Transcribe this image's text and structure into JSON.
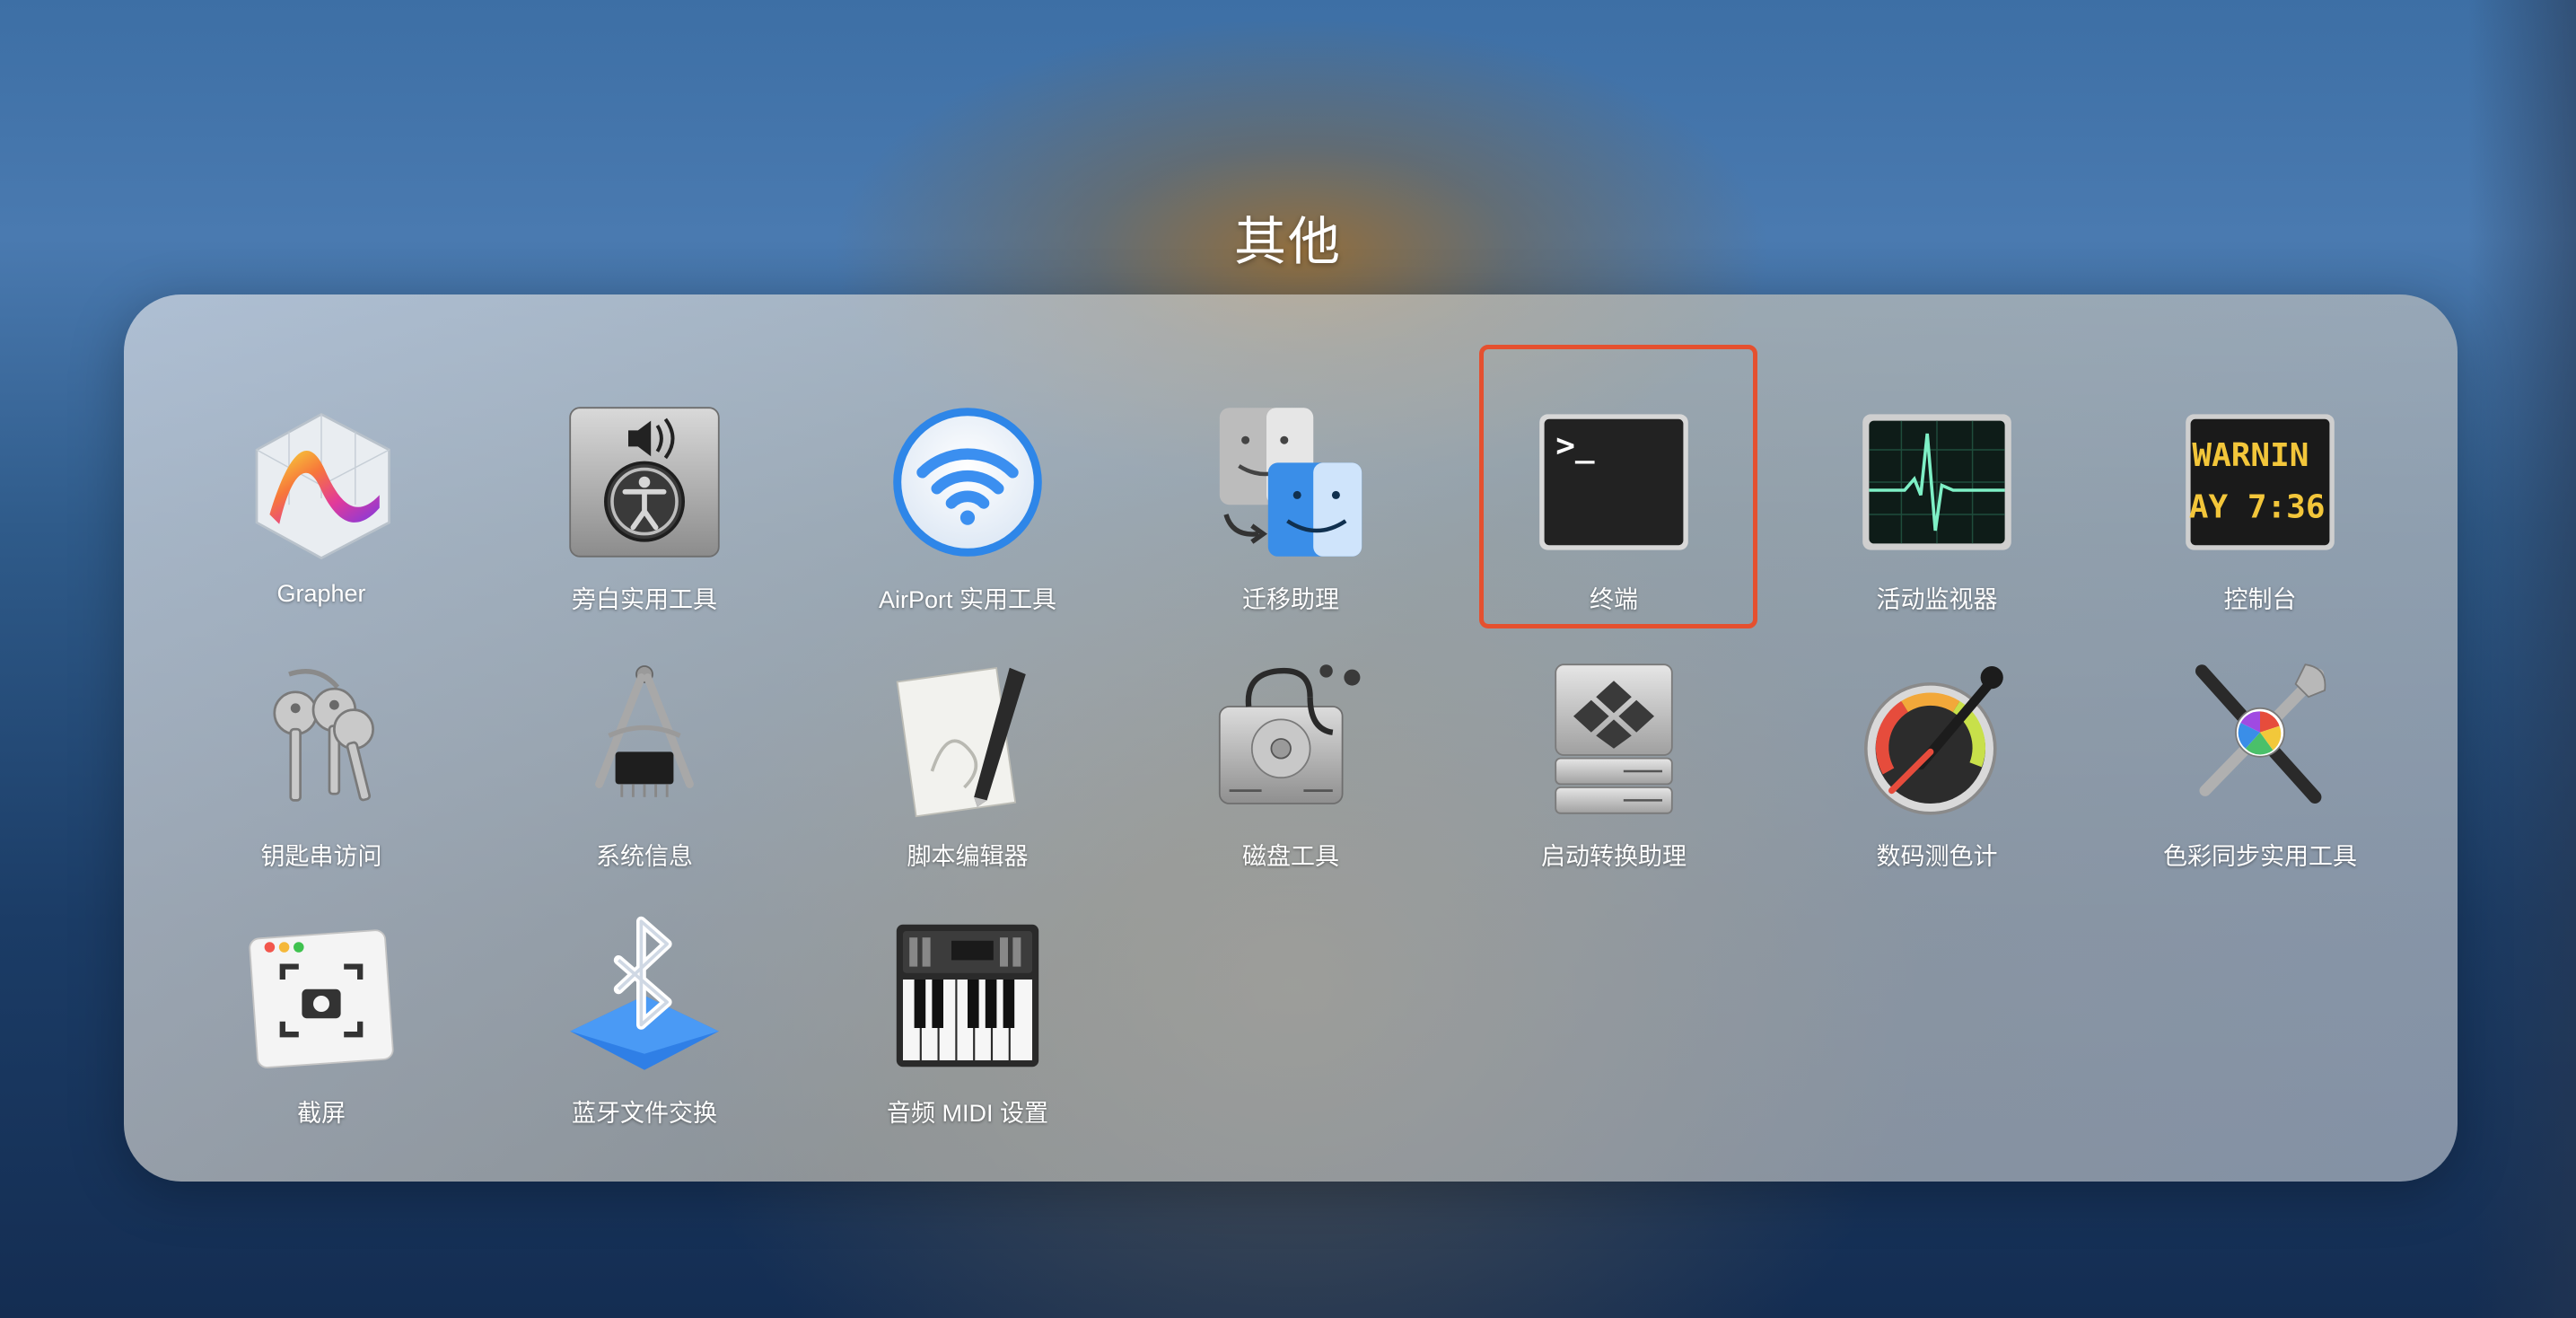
{
  "folder": {
    "title": "其他"
  },
  "apps": [
    {
      "label": "Grapher",
      "icon": "grapher-icon"
    },
    {
      "label": "旁白实用工具",
      "icon": "voiceover-utility-icon"
    },
    {
      "label": "AirPort 实用工具",
      "icon": "airport-utility-icon"
    },
    {
      "label": "迁移助理",
      "icon": "migration-assistant-icon"
    },
    {
      "label": "终端",
      "icon": "terminal-icon",
      "prompt": ">_"
    },
    {
      "label": "活动监视器",
      "icon": "activity-monitor-icon"
    },
    {
      "label": "控制台",
      "icon": "console-icon",
      "screen_line1": "WARNIN",
      "screen_line2": "AY 7:36"
    },
    {
      "label": "钥匙串访问",
      "icon": "keychain-access-icon"
    },
    {
      "label": "系统信息",
      "icon": "system-information-icon"
    },
    {
      "label": "脚本编辑器",
      "icon": "script-editor-icon"
    },
    {
      "label": "磁盘工具",
      "icon": "disk-utility-icon"
    },
    {
      "label": "启动转换助理",
      "icon": "boot-camp-assistant-icon"
    },
    {
      "label": "数码测色计",
      "icon": "digital-color-meter-icon"
    },
    {
      "label": "色彩同步实用工具",
      "icon": "colorsync-utility-icon"
    },
    {
      "label": "截屏",
      "icon": "screenshot-icon"
    },
    {
      "label": "蓝牙文件交换",
      "icon": "bluetooth-file-exchange-icon"
    },
    {
      "label": "音频 MIDI 设置",
      "icon": "audio-midi-setup-icon"
    }
  ],
  "selected_app": "终端",
  "colors": {
    "selection_border": "#e5502f"
  }
}
